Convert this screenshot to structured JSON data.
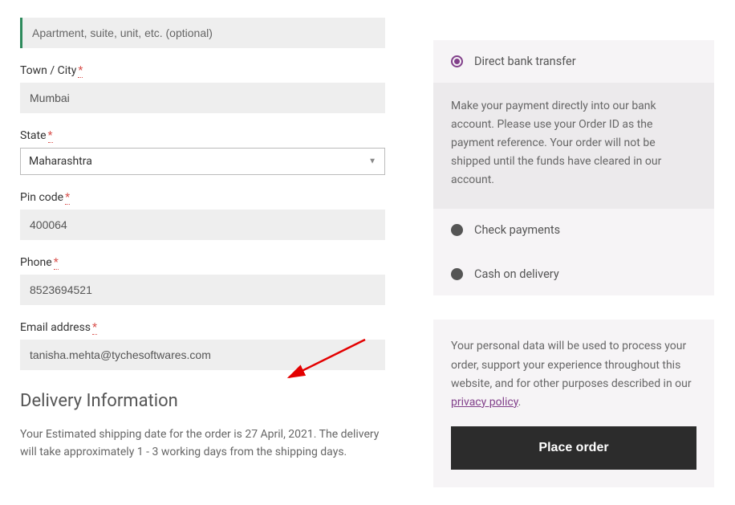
{
  "billing": {
    "address2_placeholder": "Apartment, suite, unit, etc. (optional)",
    "city_label": "Town / City",
    "city_value": "Mumbai",
    "state_label": "State",
    "state_value": "Maharashtra",
    "postcode_label": "Pin code",
    "postcode_value": "400064",
    "phone_label": "Phone",
    "phone_value": "8523694521",
    "email_label": "Email address",
    "email_value": "tanisha.mehta@tychesoftwares.com"
  },
  "delivery": {
    "heading": "Delivery Information",
    "text": "Your Estimated shipping date for the order is 27 April, 2021. The delivery will take approximately 1 - 3 working days from the shipping days."
  },
  "payment": {
    "options": [
      {
        "label": "Direct bank transfer",
        "selected": true
      },
      {
        "label": "Check payments",
        "selected": false
      },
      {
        "label": "Cash on delivery",
        "selected": false
      }
    ],
    "bank_desc": "Make your payment directly into our bank account. Please use your Order ID as the payment reference. Your order will not be shipped until the funds have cleared in our account."
  },
  "privacy": {
    "text_before": "Your personal data will be used to process your order, support your experience throughout this website, and for other purposes described in our ",
    "link": "privacy policy",
    "text_after": "."
  },
  "place_order": "Place order",
  "required_mark": "*"
}
